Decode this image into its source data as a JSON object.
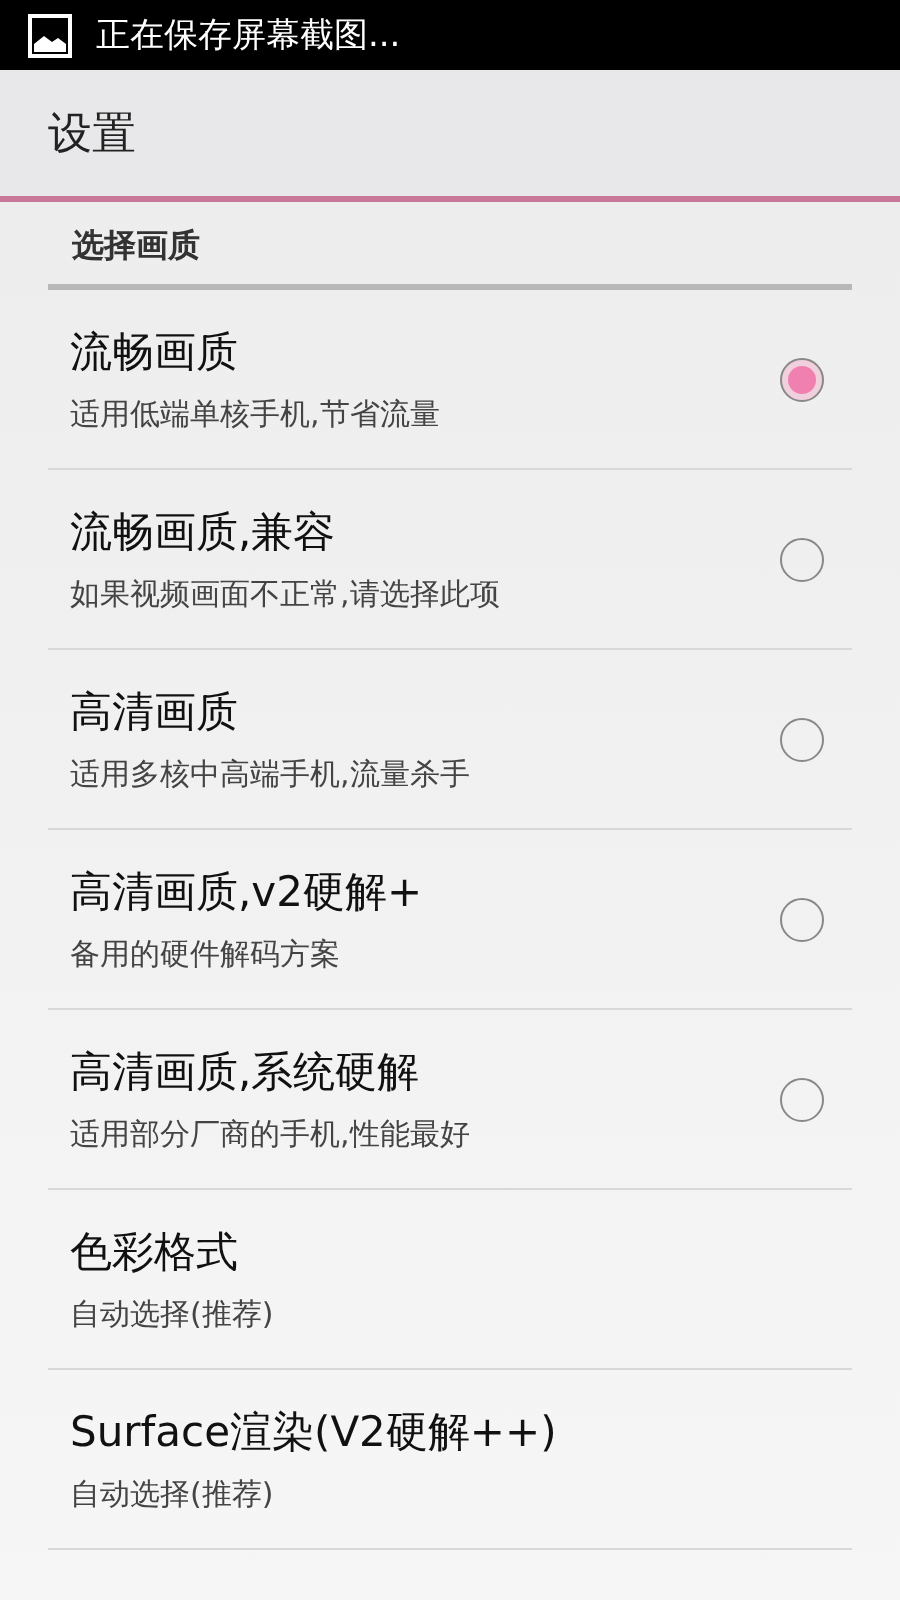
{
  "status_bar": {
    "notification": "正在保存屏幕截图..."
  },
  "action_bar": {
    "title": "设置"
  },
  "section": {
    "title": "选择画质"
  },
  "items": [
    {
      "kind": "radio",
      "title": "流畅画质",
      "summary": "适用低端单核手机,节省流量",
      "selected": true
    },
    {
      "kind": "radio",
      "title": "流畅画质,兼容",
      "summary": "如果视频画面不正常,请选择此项",
      "selected": false
    },
    {
      "kind": "radio",
      "title": "高清画质",
      "summary": "适用多核中高端手机,流量杀手",
      "selected": false
    },
    {
      "kind": "radio",
      "title": "高清画质,v2硬解+",
      "summary": "备用的硬件解码方案",
      "selected": false
    },
    {
      "kind": "radio",
      "title": "高清画质,系统硬解",
      "summary": "适用部分厂商的手机,性能最好",
      "selected": false
    },
    {
      "kind": "plain",
      "title": "色彩格式",
      "summary": "自动选择(推荐)"
    },
    {
      "kind": "plain",
      "title": "Surface渲染(V2硬解++)",
      "summary": "自动选择(推荐)"
    }
  ]
}
